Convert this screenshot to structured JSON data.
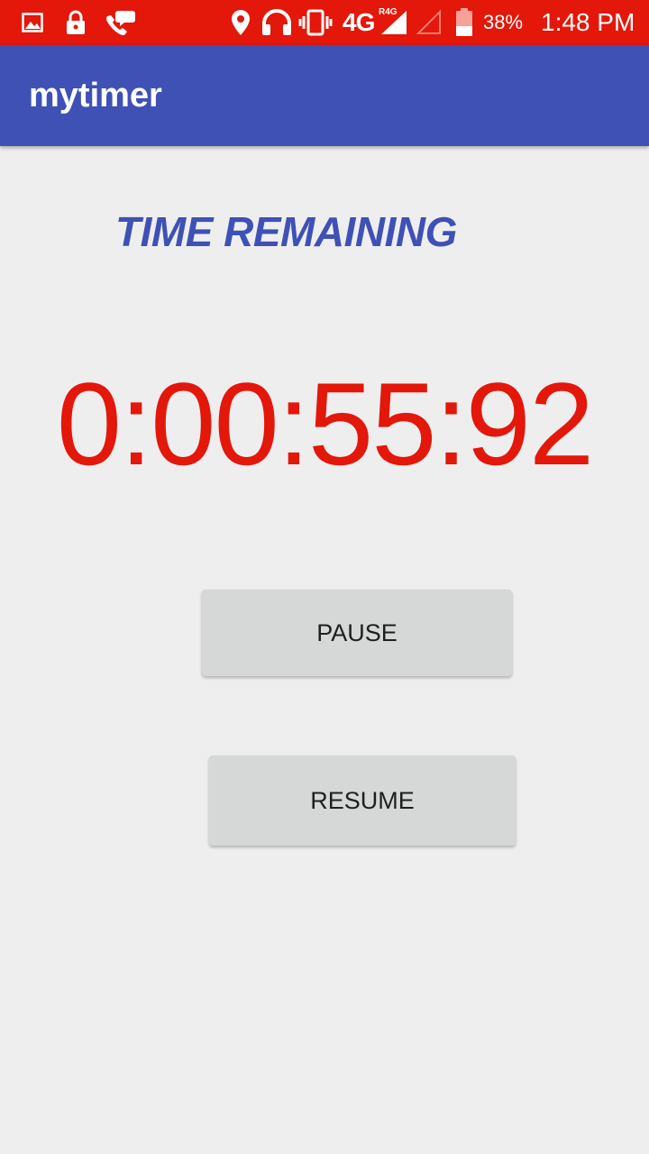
{
  "status_bar": {
    "icons": [
      "image-icon",
      "lock-icon",
      "call-chat-icon",
      "location-icon",
      "headphones-icon",
      "vibrate-icon",
      "signal-icon",
      "signal-empty-icon",
      "battery-icon"
    ],
    "network": "4G",
    "network_badge": "R4G",
    "battery": "38%",
    "time": "1:48 PM",
    "color": "#e3170a"
  },
  "app_bar": {
    "title": "mytimer",
    "color": "#3f51b5"
  },
  "main": {
    "heading": "TIME REMAINING",
    "timer": "0:00:55:92",
    "timer_color": "#e3170a",
    "pause_label": "PAUSE",
    "resume_label": "RESUME"
  }
}
